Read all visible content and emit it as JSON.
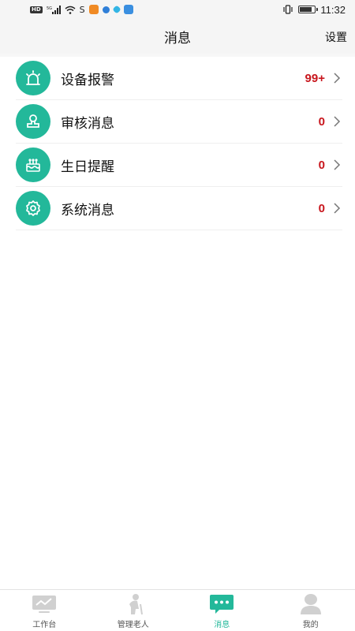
{
  "status_bar": {
    "time": "11:32",
    "network": "5G",
    "hd": "HD",
    "carrier_icon": "S",
    "battery_level": 0.85
  },
  "header": {
    "title": "消息",
    "settings_label": "设置"
  },
  "messages": [
    {
      "label": "设备报警",
      "count": "99+",
      "icon": "alarm-light-icon"
    },
    {
      "label": "审核消息",
      "count": "0",
      "icon": "stamp-icon"
    },
    {
      "label": "生日提醒",
      "count": "0",
      "icon": "birthday-cake-icon"
    },
    {
      "label": "系统消息",
      "count": "0",
      "icon": "gear-icon"
    }
  ],
  "tabs": [
    {
      "label": "工作台",
      "icon": "monitor-icon",
      "active": false
    },
    {
      "label": "管理老人",
      "icon": "elderly-person-icon",
      "active": false
    },
    {
      "label": "消息",
      "icon": "chat-bubble-icon",
      "active": true
    },
    {
      "label": "我的",
      "icon": "user-icon",
      "active": false
    }
  ],
  "colors": {
    "accent": "#23b89a",
    "count": "#c8161d",
    "inactive_tab": "#d0d0d0"
  }
}
